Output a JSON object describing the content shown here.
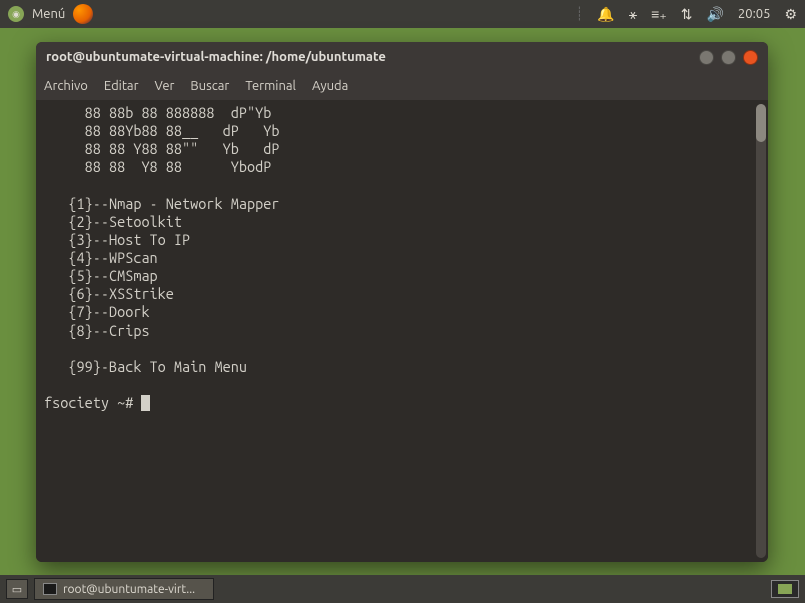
{
  "top_panel": {
    "menu_label": "Menú",
    "clock": "20:05"
  },
  "window": {
    "title": "root@ubuntumate-virtual-machine: /home/ubuntumate",
    "menus": {
      "archivo": "Archivo",
      "editar": "Editar",
      "ver": "Ver",
      "buscar": "Buscar",
      "terminal": "Terminal",
      "ayuda": "Ayuda"
    }
  },
  "terminal": {
    "ascii_art": "     88 88b 88 888888  dP\"Yb\n     88 88Yb88 88__   dP   Yb\n     88 88 Y88 88\"\"   Yb   dP\n     88 88  Y8 88      YbodP",
    "menu_items": "   {1}--Nmap - Network Mapper\n   {2}--Setoolkit\n   {3}--Host To IP\n   {4}--WPScan\n   {5}--CMSmap\n   {6}--XSStrike\n   {7}--Doork\n   {8}--Crips\n\n   {99}-Back To Main Menu",
    "prompt": "fsociety ~# "
  },
  "taskbar": {
    "task_label": "root@ubuntumate-virt..."
  }
}
